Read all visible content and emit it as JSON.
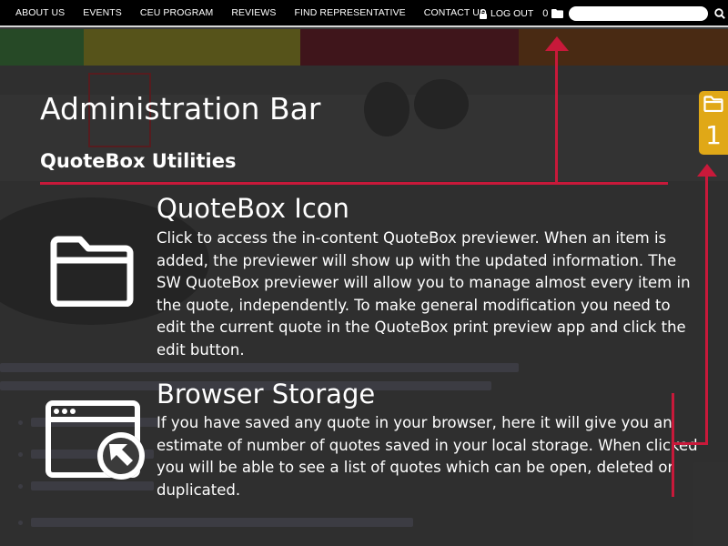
{
  "nav": {
    "items": [
      "ABOUT US",
      "EVENTS",
      "CEU PROGRAM",
      "REVIEWS",
      "FIND REPRESENTATIVE",
      "CONTACT US"
    ],
    "logout_label": "LOG OUT",
    "quote_count": "0"
  },
  "overlay": {
    "title": "Administration Bar",
    "subtitle": "QuoteBox Utilities",
    "items": [
      {
        "icon": "folder-icon",
        "title": "QuoteBox Icon",
        "description": "Click to access the in-content QuoteBox previewer. When an item is added, the previewer will show up with the updated information. The SW QuoteBox previewer will allow you to manage almost every item in the quote, independently. To make general modification you need to edit the current quote in the QuoteBox print preview app and click the edit button."
      },
      {
        "icon": "browser-storage-icon",
        "title": "Browser Storage",
        "description": "If you have saved any quote in your browser, here it will give you an estimate of number of quotes saved in your local storage. When clicked you will be able to see a list of quotes which can be open, deleted or duplicated."
      }
    ]
  },
  "side_tab": {
    "icon": "folder-icon",
    "count": "1"
  },
  "colors": {
    "accent": "#c8193a",
    "tab": "#e0a817",
    "topbar": "#000000"
  }
}
